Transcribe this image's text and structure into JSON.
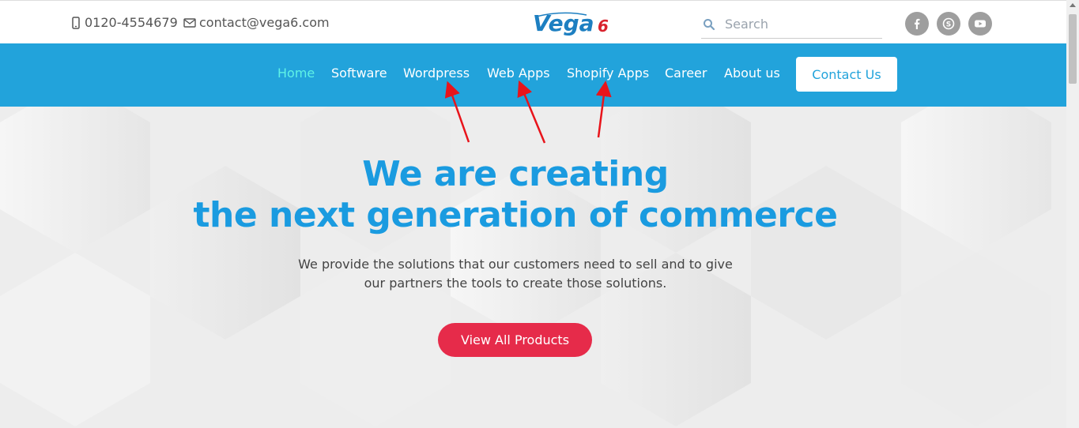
{
  "topbar": {
    "phone": "0120-4554679",
    "email": "contact@vega6.com",
    "phone_icon": "mobile-phone-icon",
    "email_icon": "envelope-icon"
  },
  "logo": {
    "text_main": "Vega",
    "text_accent": "6",
    "main_color": "#1d7fc1",
    "accent_color": "#d9232e"
  },
  "search": {
    "placeholder": "Search",
    "icon": "search-icon"
  },
  "social": [
    {
      "name": "facebook",
      "icon": "facebook-icon"
    },
    {
      "name": "skype",
      "icon": "skype-icon"
    },
    {
      "name": "youtube",
      "icon": "youtube-icon"
    }
  ],
  "nav": {
    "items": [
      {
        "label": "Home",
        "active": true
      },
      {
        "label": "Software"
      },
      {
        "label": "Wordpress"
      },
      {
        "label": "Web Apps"
      },
      {
        "label": "Shopify Apps"
      },
      {
        "label": "Career"
      },
      {
        "label": "About us"
      }
    ],
    "contact_button": "Contact Us"
  },
  "hero": {
    "headline_line1": "We are creating",
    "headline_line2": "the next generation of commerce",
    "subtext_line1": "We provide the solutions that our customers need to sell and to give",
    "subtext_line2": "our partners the tools to create those solutions.",
    "cta": "View All Products"
  },
  "colors": {
    "nav_bg": "#22a3db",
    "active_nav": "#5ff2e6",
    "headline": "#1a9be0",
    "cta_bg": "#e62b4a",
    "arrow": "#e8141b"
  }
}
